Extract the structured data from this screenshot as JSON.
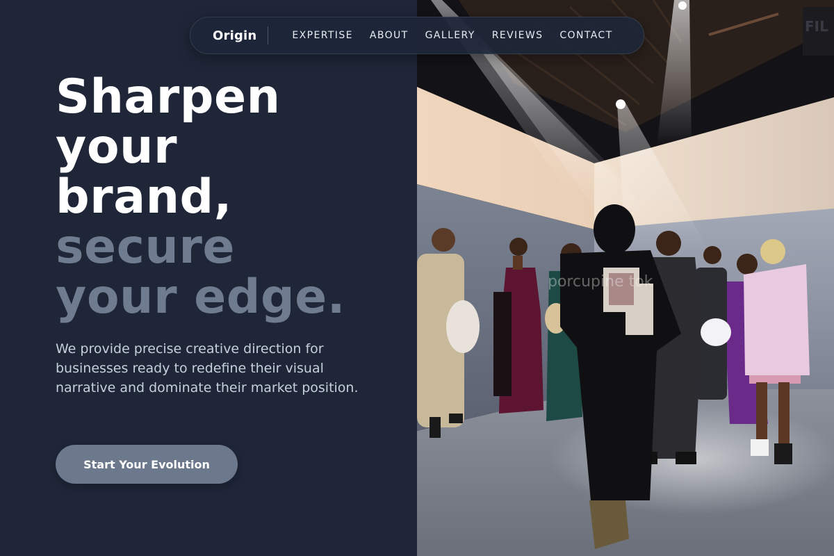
{
  "nav": {
    "brand": "Origin",
    "links": [
      {
        "label": "EXPERTISE"
      },
      {
        "label": "ABOUT"
      },
      {
        "label": "GALLERY"
      },
      {
        "label": "REVIEWS"
      },
      {
        "label": "CONTACT"
      }
    ]
  },
  "hero": {
    "headline_lines": [
      "Sharpen",
      "your",
      "brand,",
      "secure",
      "your edge."
    ],
    "description": "We provide precise creative direction for businesses ready to redefine their visual narrative and dominate their market position.",
    "cta_label": "Start Your Evolution"
  },
  "photo": {
    "sign_text": "FIL BRA",
    "garment_text": "porcupine tok"
  },
  "colors": {
    "background": "#1e2638",
    "headline_primary": "#ffffff",
    "headline_muted": "#6f7b8f",
    "body_text": "#c6cfdc",
    "cta_background": "#6c788c"
  }
}
